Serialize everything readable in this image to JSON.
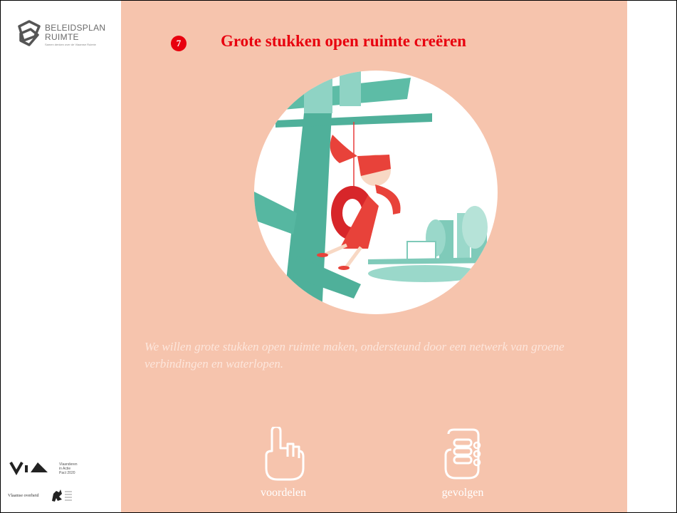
{
  "sidebar": {
    "logo": {
      "line1": "BELEIDSPLAN",
      "line2": "RUIMTE",
      "tagline": "Samen denken over de Vlaamse Ruimte"
    },
    "via": {
      "mark": "ViA",
      "lines": [
        "Vlaanderen",
        "in Actie",
        "Pact 2020"
      ]
    },
    "vo": {
      "text": "Vlaamse overheid"
    }
  },
  "main": {
    "number": "7",
    "title": "Grote stukken open ruimte creëren",
    "description": "We willen grote stukken open ruimte maken, ondersteund door een netwerk van groene verbindingen en waterlopen.",
    "buttons": [
      {
        "label": "voordelen",
        "icon": "pointing-hand-icon"
      },
      {
        "label": "gevolgen",
        "icon": "fist-hand-icon"
      }
    ]
  },
  "colors": {
    "background": "#f6c4ad",
    "accent": "#e8000e",
    "teal": "#4fb09a"
  }
}
